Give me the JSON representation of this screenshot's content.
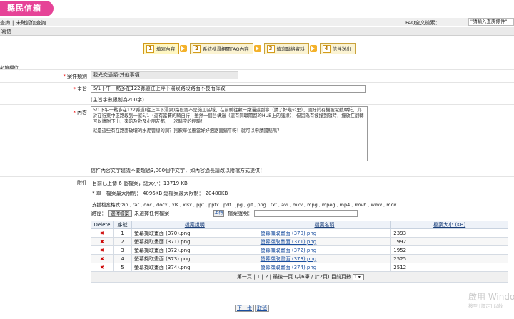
{
  "header": {
    "logo_text": "縣民信箱"
  },
  "nav": {
    "links": [
      "查詢",
      "未確認信查詢"
    ],
    "separator": "|",
    "faq_label": "FAQ全文檢索：",
    "faq_placeholder": "\"請輸入查詢條件\""
  },
  "section_title": "寫信",
  "steps": [
    {
      "num": "1",
      "label": "填寫內容"
    },
    {
      "num": "2",
      "label": "系統搜尋相關FAQ內容"
    },
    {
      "num": "3",
      "label": "填寫聯絡資料"
    },
    {
      "num": "4",
      "label": "信件送出"
    }
  ],
  "required_note": "必填欄位，",
  "form": {
    "case_type_label": "案件類別",
    "case_type_value": "觀光交通類-其他事項",
    "subject_label": "主旨",
    "subject_value": "5/1下午一點多在122縣道往上坪下湯泉路段路面不良而摔跤",
    "subject_hint": "(主旨字數限制為200字)",
    "content_label": "內容",
    "content_p1": "5/1下午一點多在122縣道(往上坪下湯泉)路段要不是施工區域，在前騎往數一路漫遊到寧（請了好幾公里），國好於有機被電動摩托，邱於在行東中正路段到一家5/1（還有當賽的騎自行！雖然一個台構過（還有同職關都的HUB上的護線），但因為有被撞到隨時，撞放在翻轉可以請附下山，來的及救及小朋友都，一次騎空的經驗！",
    "content_p2": "就是這些有在路面破壞的水泥管線的洞？抱歉單位應當好好把路面鋪平呀！就可以申請國賠嗎？",
    "content_hint": "信件內容文字建議不要超過3,000個中文字，如內容過長請改以附檔方式提供！",
    "attach_label": "附件",
    "attach_count": "目前已上傳 6 個檔案，總大小：13719 KB",
    "attach_limit": "* 單一檔案最大限制： 4096KB 總檔案最大限制： 20480KB",
    "attach_types": "支援檔案格式:zip , rar , doc , docx , xls , xlsx , ppt , pptx , pdf , jpg , gif , png , txt , avi , mkv , mpg , mpeg , mp4 , rmvb , wmv , mov",
    "path_label": "路徑：",
    "choose_button": "選擇檔案",
    "no_file_text": "未選擇任何檔案",
    "upload_button": "上傳",
    "desc_label": "檔案說明："
  },
  "table": {
    "headers": [
      "Delete",
      "序號",
      "檔案說明",
      "檔案名稱",
      "檔案大小 (KB)"
    ],
    "rows": [
      {
        "delete": "✖",
        "seq": "1",
        "desc": "螢幕擷取畫面 (370).png",
        "name": "螢幕擷取畫面 (370).png",
        "size": "2393"
      },
      {
        "delete": "✖",
        "seq": "2",
        "desc": "螢幕擷取畫面 (371).png",
        "name": "螢幕擷取畫面 (371).png",
        "size": "1992"
      },
      {
        "delete": "✖",
        "seq": "3",
        "desc": "螢幕擷取畫面 (372).png",
        "name": "螢幕擷取畫面 (372).png",
        "size": "1952"
      },
      {
        "delete": "✖",
        "seq": "4",
        "desc": "螢幕擷取畫面 (373).png",
        "name": "螢幕擷取畫面 (373).png",
        "size": "2525"
      },
      {
        "delete": "✖",
        "seq": "5",
        "desc": "螢幕擷取畫面 (374).png",
        "name": "螢幕擷取畫面 (374).png",
        "size": "2512"
      }
    ],
    "pager_text": "第一頁 | 1 | 2 | 最後一頁 (共6筆 / 計2頁) 目前頁數",
    "pager_value": "1 ▾"
  },
  "buttons": {
    "next": "下一步",
    "cancel": "取消"
  },
  "watermark": {
    "line1": "啟用 Windo",
    "line2": "移至 [設定] 以啟"
  },
  "colors": {
    "logo": "#e64397",
    "step_border": "#d39b1b",
    "link": "#1a4fa0"
  }
}
